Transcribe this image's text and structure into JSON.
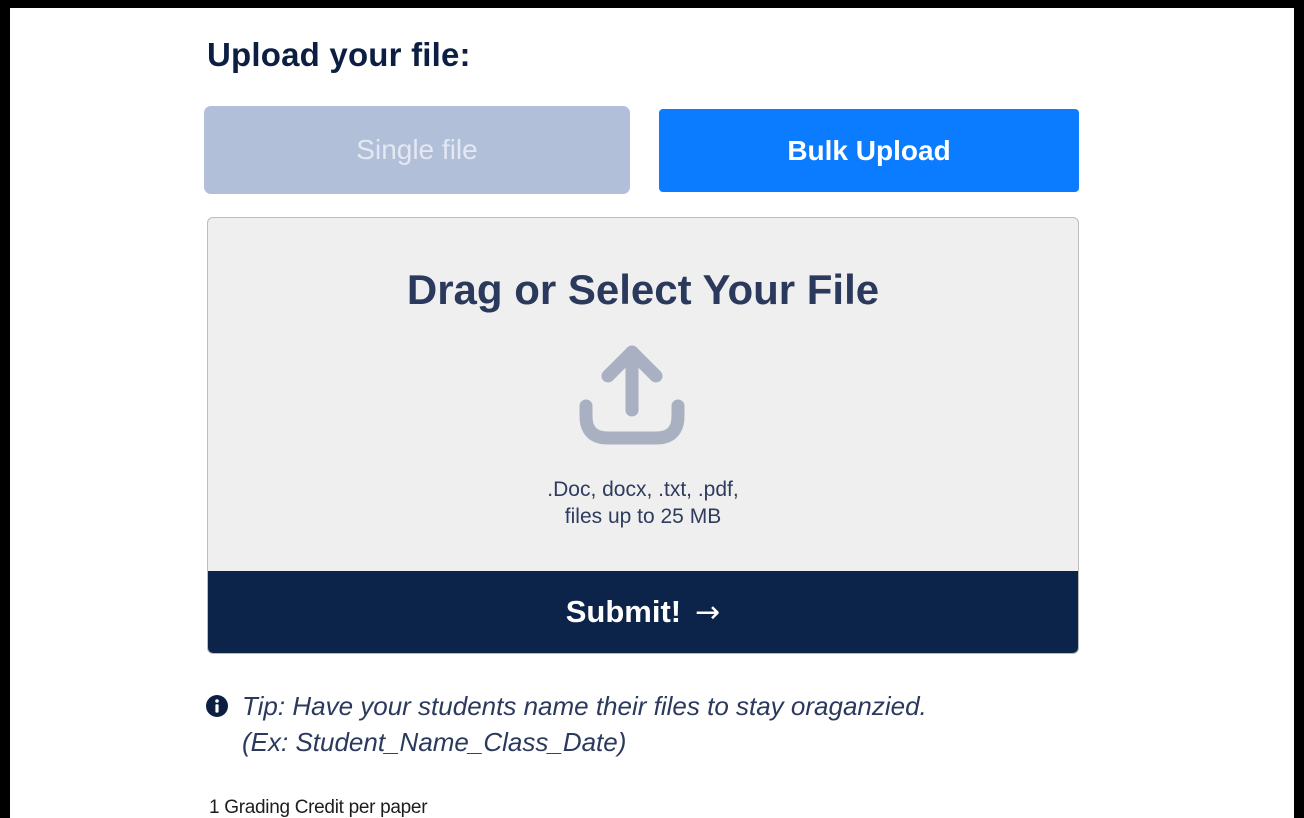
{
  "upload": {
    "heading": "Upload your file:",
    "tabs": {
      "single": "Single file",
      "bulk": "Bulk Upload"
    },
    "dropzone": {
      "title": "Drag or Select Your File",
      "icon": "upload-icon",
      "formats": ".Doc, docx, .txt, .pdf,",
      "limit": "files up to 25 MB"
    },
    "submit": {
      "label": "Submit!",
      "arrow": "→"
    },
    "tip": {
      "icon": "info-icon",
      "line1": "Tip: Have your students name their files to stay oraganzied.",
      "line2": "(Ex: Student_Name_Class_Date)"
    },
    "credit": "1 Grading Credit per paper"
  },
  "colors": {
    "frame": "#000000",
    "heading": "#0c1f43",
    "tab_inactive_bg": "#b2bfd9",
    "tab_active_bg": "#0b7cff",
    "dropzone_bg": "#efefef",
    "icon": "#a8b0c2",
    "submit_bg": "#0c244a"
  }
}
